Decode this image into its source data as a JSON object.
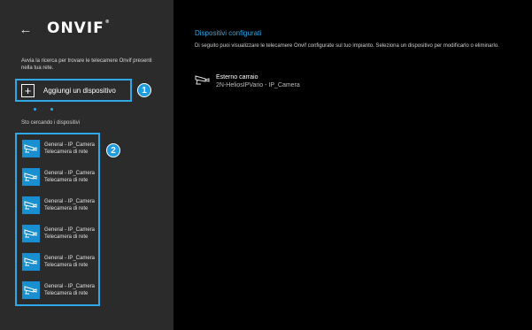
{
  "header": {
    "back_label": "←",
    "logo_text": "ONVIF",
    "logo_mark": "®"
  },
  "sidebar": {
    "intro": "Avvia la ricerca per trovare le telecamere Onvif presenti nella tua rete.",
    "add_button_label": "Aggiungi un dispositivo",
    "searching_label": "Sto cercando i dispositivi",
    "devices": [
      {
        "name": "General - IP_Camera",
        "type": "Telecamera di rete",
        "icon": "camera-icon"
      },
      {
        "name": "General - IP_Camera",
        "type": "Telecamera di rete",
        "icon": "camera-icon"
      },
      {
        "name": "General - IP_Camera",
        "type": "Telecamera di rete",
        "icon": "camera-icon"
      },
      {
        "name": "General - IP_Camera",
        "type": "Telecamera di rete",
        "icon": "camera-icon"
      },
      {
        "name": "General - IP_Camera",
        "type": "Telecamera di rete",
        "icon": "camera-icon"
      },
      {
        "name": "General - IP_Camera",
        "type": "Telecamera di rete",
        "icon": "camera-icon"
      }
    ]
  },
  "badges": {
    "first": "1",
    "second": "2"
  },
  "main": {
    "title": "Dispositivi configurati",
    "description": "Di seguito puoi visualizzare le telecamere Onvif configurate sul tuo impianto. Seleziona un dispositivo per modificarlo o eliminarlo.",
    "configured": [
      {
        "name": "Esterno carraio",
        "model": "2N-HeliosIPVario - IP_Camera",
        "icon": "camera-icon"
      }
    ]
  },
  "colors": {
    "accent": "#2ea8e6",
    "sidebar_bg": "#2b2b2b",
    "main_bg": "#000000",
    "tile_bg": "#1a8fd0"
  }
}
